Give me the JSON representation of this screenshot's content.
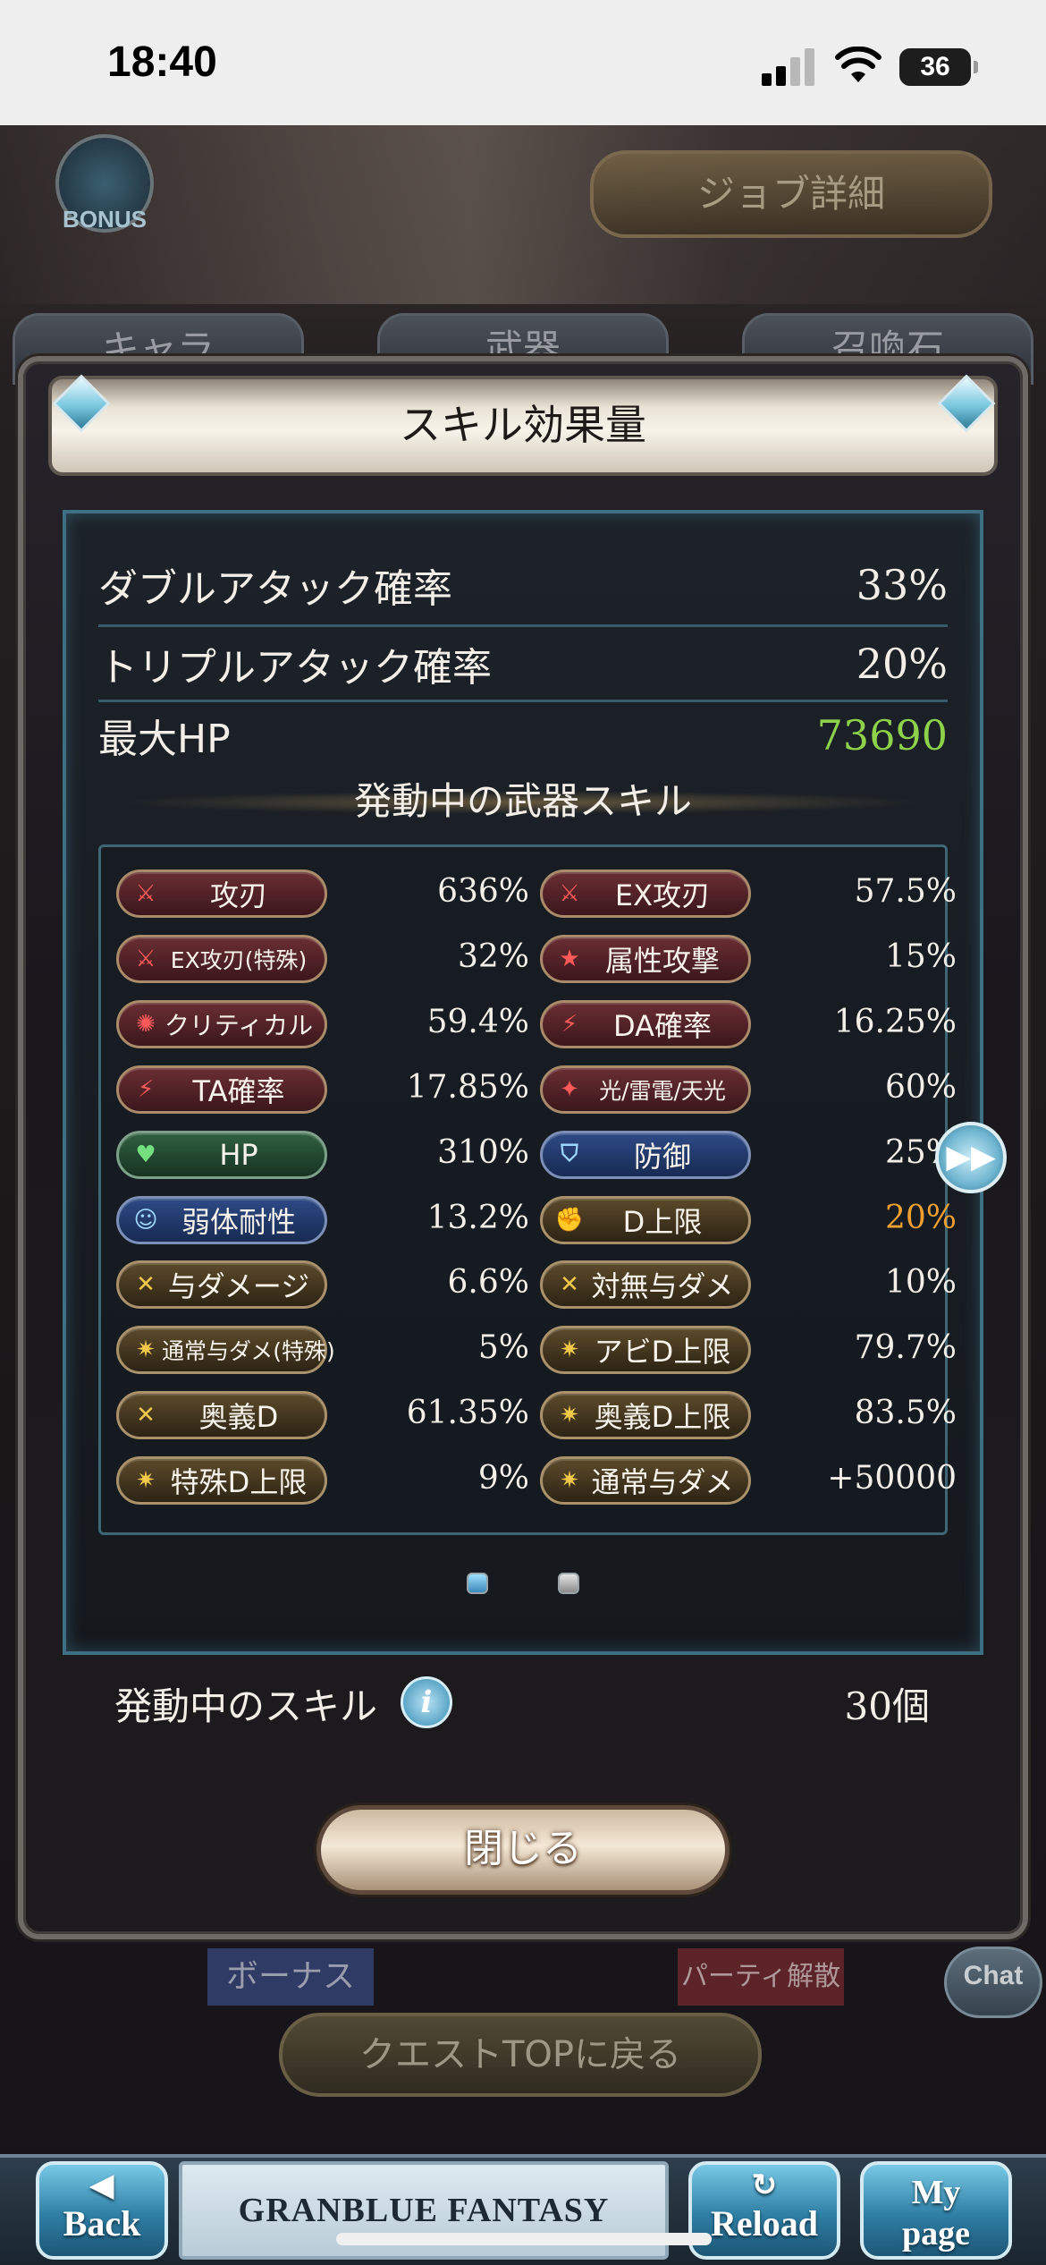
{
  "status_bar": {
    "time": "18:40",
    "battery": "36",
    "icons": [
      "signal-icon",
      "wifi-icon",
      "battery-icon"
    ]
  },
  "background": {
    "bonus_badge": "BONUS",
    "job_detail_button": "ジョブ詳細",
    "tabs": [
      "キャラ",
      "武器",
      "召喚石"
    ],
    "bonus_tab": "ボーナス",
    "disband_tab": "パーティ解散",
    "chat": "Chat",
    "quest_top_button": "クエストTOPに戻る"
  },
  "modal": {
    "title": "スキル効果量",
    "stats": [
      {
        "label": "ダブルアタック確率",
        "value": "33%"
      },
      {
        "label": "トリプルアタック確率",
        "value": "20%"
      },
      {
        "label": "最大HP",
        "value": "73690"
      }
    ],
    "section_title": "発動中の武器スキル",
    "skills": [
      {
        "label": "攻刃",
        "value": "636%",
        "icon": "sword-icon",
        "style": "red"
      },
      {
        "label": "EX攻刃",
        "value": "57.5%",
        "icon": "sword-icon",
        "style": "red"
      },
      {
        "label": "EX攻刃(特殊)",
        "value": "32%",
        "icon": "sword-icon",
        "style": "red"
      },
      {
        "label": "属性攻撃",
        "value": "15%",
        "icon": "star-icon",
        "style": "red"
      },
      {
        "label": "クリティカル",
        "value": "59.4%",
        "icon": "burst-icon",
        "style": "red"
      },
      {
        "label": "DA確率",
        "value": "16.25%",
        "icon": "double-slash-icon",
        "style": "red"
      },
      {
        "label": "TA確率",
        "value": "17.85%",
        "icon": "triple-slash-icon",
        "style": "red"
      },
      {
        "label": "光/雷電/天光",
        "value": "60%",
        "icon": "flame-icon",
        "style": "red"
      },
      {
        "label": "HP",
        "value": "310%",
        "icon": "heart-icon",
        "style": "green"
      },
      {
        "label": "防御",
        "value": "25%",
        "icon": "shield-icon",
        "style": "blue"
      },
      {
        "label": "弱体耐性",
        "value": "13.2%",
        "icon": "person-icon",
        "style": "blue"
      },
      {
        "label": "D上限",
        "value": "20%",
        "icon": "gauntlet-icon",
        "style": "gold",
        "highlight": "#f0a030"
      },
      {
        "label": "与ダメージ",
        "value": "6.6%",
        "icon": "cross-swords-icon",
        "style": "gold"
      },
      {
        "label": "対無与ダメ",
        "value": "10%",
        "icon": "cross-swords-icon",
        "style": "gold"
      },
      {
        "label": "通常与ダメ(特殊)",
        "value": "5%",
        "icon": "sparkle-icon",
        "style": "gold"
      },
      {
        "label": "アビD上限",
        "value": "79.7%",
        "icon": "sparkle-icon",
        "style": "gold"
      },
      {
        "label": "奥義D",
        "value": "61.35%",
        "icon": "cross-swords-icon",
        "style": "gold"
      },
      {
        "label": "奥義D上限",
        "value": "83.5%",
        "icon": "sparkle-icon",
        "style": "gold"
      },
      {
        "label": "特殊D上限",
        "value": "9%",
        "icon": "sparkle-icon",
        "style": "gold"
      },
      {
        "label": "通常与ダメ",
        "value": "+50000",
        "icon": "sparkle-icon",
        "style": "gold"
      }
    ],
    "page_indicator": {
      "current": 1,
      "total": 2
    },
    "active_skills_label": "発動中のスキル",
    "active_skills_value": "30個",
    "close_button": "閉じる"
  },
  "bottom_nav": {
    "back": "Back",
    "logo": "GRANBLUE FANTASY",
    "reload": "Reload",
    "my_page": "My page"
  },
  "colors": {
    "max_hp_value": "#8ed14a",
    "highlight_value": "#f0a030",
    "panel_border": "#3f6f83"
  }
}
